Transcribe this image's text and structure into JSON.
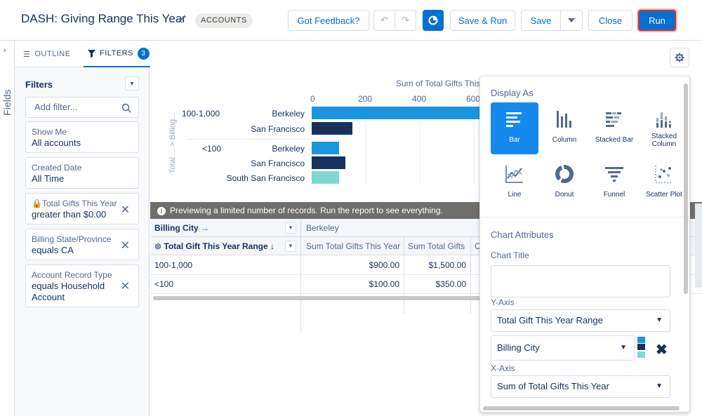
{
  "header": {
    "title": "DASH: Giving Range This Year",
    "badge": "ACCOUNTS",
    "feedback": "Got Feedback?",
    "undo": "↶",
    "redo": "↷",
    "save_run": "Save & Run",
    "save": "Save",
    "close": "Close",
    "run": "Run"
  },
  "sidebar": {
    "fields_label": "Fields",
    "chevron": "›"
  },
  "panel": {
    "tab_outline": "OUTLINE",
    "tab_filters": "FILTERS",
    "filter_count": "3",
    "filters_heading": "Filters",
    "add_filter_placeholder": "Add filter...",
    "filters": [
      {
        "label": "Show Me",
        "value": "All accounts"
      },
      {
        "label": "Created Date",
        "value": "All Time"
      },
      {
        "label": "Total Gifts This Year",
        "value": "greater than $0.00",
        "locked": true
      },
      {
        "label": "Billing State/Province",
        "value": "equals CA"
      },
      {
        "label": "Account Record Type",
        "value": "equals Household Account"
      }
    ]
  },
  "chart_data": {
    "type": "bar",
    "orientation": "horizontal",
    "title": "Sum of Total Gifts This",
    "xlabel": "",
    "ylabel": "Total ... > Billing...",
    "x_ticks": [
      "0",
      "200",
      "400",
      "600"
    ],
    "groups": [
      {
        "name": "100-1,000",
        "rows": [
          {
            "city": "Berkeley",
            "value": 900,
            "color": "#1b96de"
          },
          {
            "city": "San Francisco",
            "value": 150,
            "color": "#16325c"
          }
        ]
      },
      {
        "name": "<100",
        "rows": [
          {
            "city": "Berkeley",
            "value": 100,
            "color": "#1b96de"
          },
          {
            "city": "San Francisco",
            "value": 125,
            "color": "#16325c"
          },
          {
            "city": "South San Francisco",
            "value": 100,
            "color": "#7fd8d2"
          }
        ]
      }
    ]
  },
  "banner": "Previewing a limited number of records. Run the report to see everything.",
  "table": {
    "col_group_label": "Billing City",
    "col_group_value": "Berkeley",
    "row_group_label": "Total Gift This Year Range",
    "col_headers": [
      "Sum Total Gifts This Year",
      "Sum Total Gifts",
      "C"
    ],
    "rows": [
      {
        "range": "100-1,000",
        "values": [
          "$900.00",
          "$1,500.00"
        ]
      },
      {
        "range": "<100",
        "values": [
          "$100.00",
          "$350.00"
        ]
      }
    ]
  },
  "chart_settings": {
    "display_as": "Display As",
    "types": [
      "Bar",
      "Column",
      "Stacked Bar",
      "Stacked Column",
      "Line",
      "Donut",
      "Funnel",
      "Scatter Plot"
    ],
    "selected_type": "Bar",
    "attributes_heading": "Chart Attributes",
    "chart_title_label": "Chart Title",
    "chart_title_value": "",
    "y_axis_label": "Y-Axis",
    "y_axis_value": "Total Gift This Year Range",
    "group_value": "Billing City",
    "x_axis_label": "X-Axis",
    "x_axis_value": "Sum of Total Gifts This Year",
    "swatch_colors": [
      "#1b96de",
      "#16325c",
      "#7fd8d2"
    ]
  },
  "colors": {
    "accent": "#0070d2",
    "run_border": "#c23934",
    "banner_bg": "#706e6b"
  }
}
